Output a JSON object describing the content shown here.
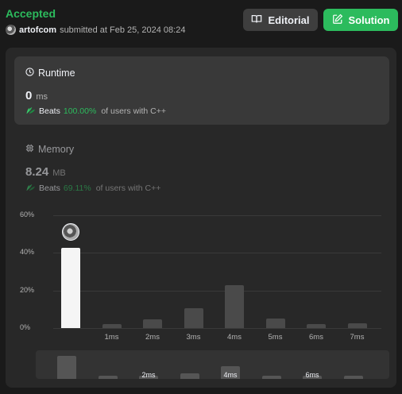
{
  "submission": {
    "status": "Accepted",
    "user": "artofcom",
    "submitted_text": "submitted at Feb 25, 2024 08:24"
  },
  "buttons": {
    "editorial": "Editorial",
    "solution": "Solution"
  },
  "runtime": {
    "title": "Runtime",
    "value": "0",
    "unit": "ms",
    "beats_label": "Beats",
    "beats_pct": "100.00%",
    "beats_rest": "of users with C++"
  },
  "memory": {
    "title": "Memory",
    "value": "8.24",
    "unit": "MB",
    "beats_label": "Beats",
    "beats_pct": "69.11%",
    "beats_rest": "of users with C++"
  },
  "colors": {
    "accent": "#2cbb5d",
    "background": "#1a1a1a",
    "panel": "#282828",
    "card": "#393939"
  },
  "icons": [
    "clock-icon",
    "chip-icon",
    "book-icon",
    "edit-icon",
    "leaf-icon"
  ],
  "chart_data": {
    "type": "bar",
    "categories": [
      "0ms",
      "1ms",
      "2ms",
      "3ms",
      "4ms",
      "5ms",
      "6ms",
      "7ms"
    ],
    "tick_labels": [
      "",
      "1ms",
      "2ms",
      "3ms",
      "4ms",
      "5ms",
      "6ms",
      "7ms"
    ],
    "values": [
      42.5,
      2,
      4.5,
      10.5,
      23,
      5,
      2,
      2.5
    ],
    "highlight_index": 0,
    "yticks": [
      "60%",
      "40%",
      "20%",
      "0%"
    ],
    "ylim": [
      0,
      60
    ],
    "minimap_ticks": [
      "2ms",
      "4ms",
      "6ms"
    ]
  }
}
